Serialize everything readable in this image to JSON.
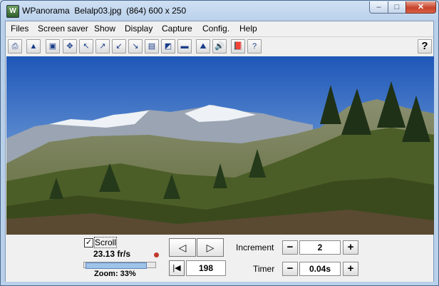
{
  "window": {
    "app_name": "WPanorama",
    "title": "WPanorama  Belalp03.jpg  (864) 600 x 250",
    "min": "–",
    "max": "□",
    "close": "✕"
  },
  "menu": [
    "Files",
    "Screen saver",
    "Show",
    "Display",
    "Capture",
    "Config.",
    "Help"
  ],
  "toolbar": {
    "buttons": [
      "open-icon",
      "picture-icon",
      "frame-icon",
      "move-icon",
      "arrow-upleft-icon",
      "arrow-upright-icon",
      "arrow-downleft-icon",
      "arrow-downright-icon",
      "panorama-view-icon",
      "panorama-color-icon",
      "panorama-band-icon",
      "mountain-icon",
      "sound-icon",
      "book-icon",
      "help-page-icon"
    ],
    "glyphs": [
      "⎙",
      "▲",
      "▣",
      "✥",
      "↖",
      "↗",
      "↙",
      "↘",
      "▤",
      "◩",
      "▬",
      "⛰",
      "🔊",
      "📕",
      "?"
    ],
    "help": "?"
  },
  "controls": {
    "scroll_label": "Scroll",
    "scroll_checked": "✓",
    "fps": "23.13 fr/s",
    "zoom": "Zoom: 33%",
    "zoom_value": 33,
    "prev": "◁",
    "next": "▷",
    "first": "|◀",
    "frame_value": "198",
    "increment_label": "Increment",
    "increment_value": "2",
    "timer_label": "Timer",
    "timer_value": "0.04s",
    "minus": "−",
    "plus": "+"
  },
  "colors": {
    "title_bar": "#b9d0ea",
    "close": "#c7432a",
    "sky": "#3a72c7"
  }
}
